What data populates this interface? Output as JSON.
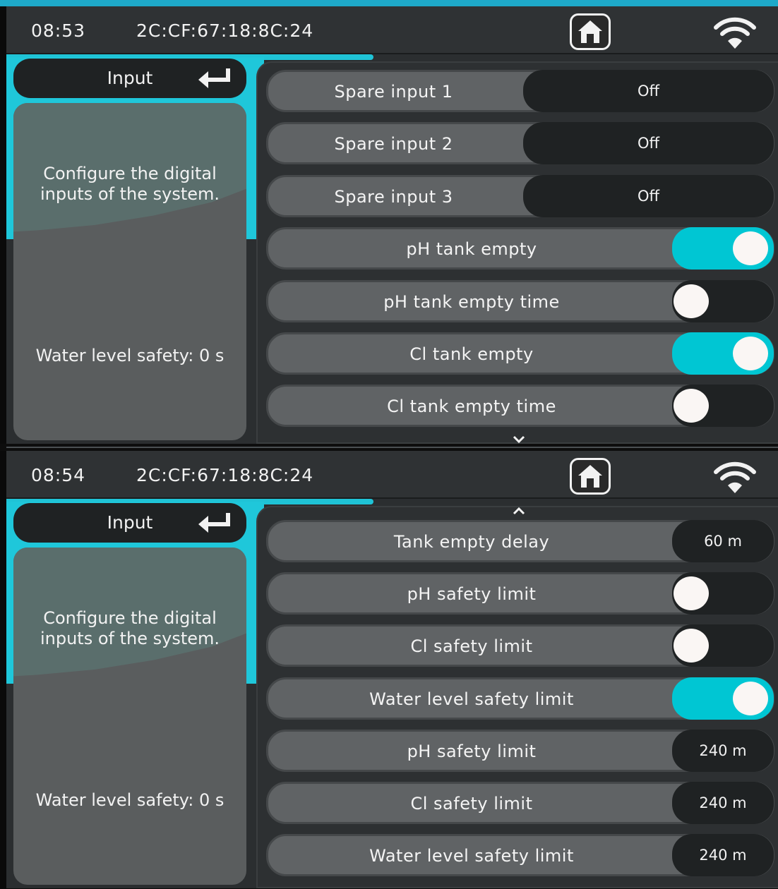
{
  "screens": [
    {
      "header": {
        "time": "08:53",
        "mac": "2C:CF:67:18:8C:24"
      },
      "sidebar": {
        "back_label": "Input",
        "description_line1": "Configure the digital",
        "description_line2": "inputs of the system.",
        "status": "Water level safety: 0 s"
      },
      "rows": [
        {
          "label": "Spare input 1",
          "value": "Off"
        },
        {
          "label": "Spare input 2",
          "value": "Off"
        },
        {
          "label": "Spare input 3",
          "value": "Off"
        },
        {
          "label": "pH tank empty",
          "toggle": "on"
        },
        {
          "label": "pH tank empty time",
          "toggle": "off"
        },
        {
          "label": "Cl tank empty",
          "toggle": "on"
        },
        {
          "label": "Cl tank empty time",
          "toggle": "off"
        }
      ]
    },
    {
      "header": {
        "time": "08:54",
        "mac": "2C:CF:67:18:8C:24"
      },
      "sidebar": {
        "back_label": "Input",
        "description_line1": "Configure the digital",
        "description_line2": "inputs of the system.",
        "status": "Water level safety: 0 s"
      },
      "rows": [
        {
          "label": "Tank empty delay",
          "value": "60 m"
        },
        {
          "label": "pH safety limit",
          "toggle": "off"
        },
        {
          "label": "Cl safety limit",
          "toggle": "off"
        },
        {
          "label": "Water level safety limit",
          "toggle": "on"
        },
        {
          "label": "pH safety limit",
          "value": "240 m"
        },
        {
          "label": "Cl safety limit",
          "value": "240 m"
        },
        {
          "label": "Water level safety limit",
          "value": "240 m"
        }
      ]
    }
  ],
  "colors": {
    "accent": "#00c6d3",
    "row_bg": "#606365",
    "dark": "#1f2223",
    "knob": "#faf6f4"
  },
  "icons": {
    "home": "home-icon",
    "wifi": "wifi-icon",
    "back": "return-arrow-icon",
    "scroll_down": "chevron-down-icon",
    "scroll_up": "chevron-up-icon"
  }
}
